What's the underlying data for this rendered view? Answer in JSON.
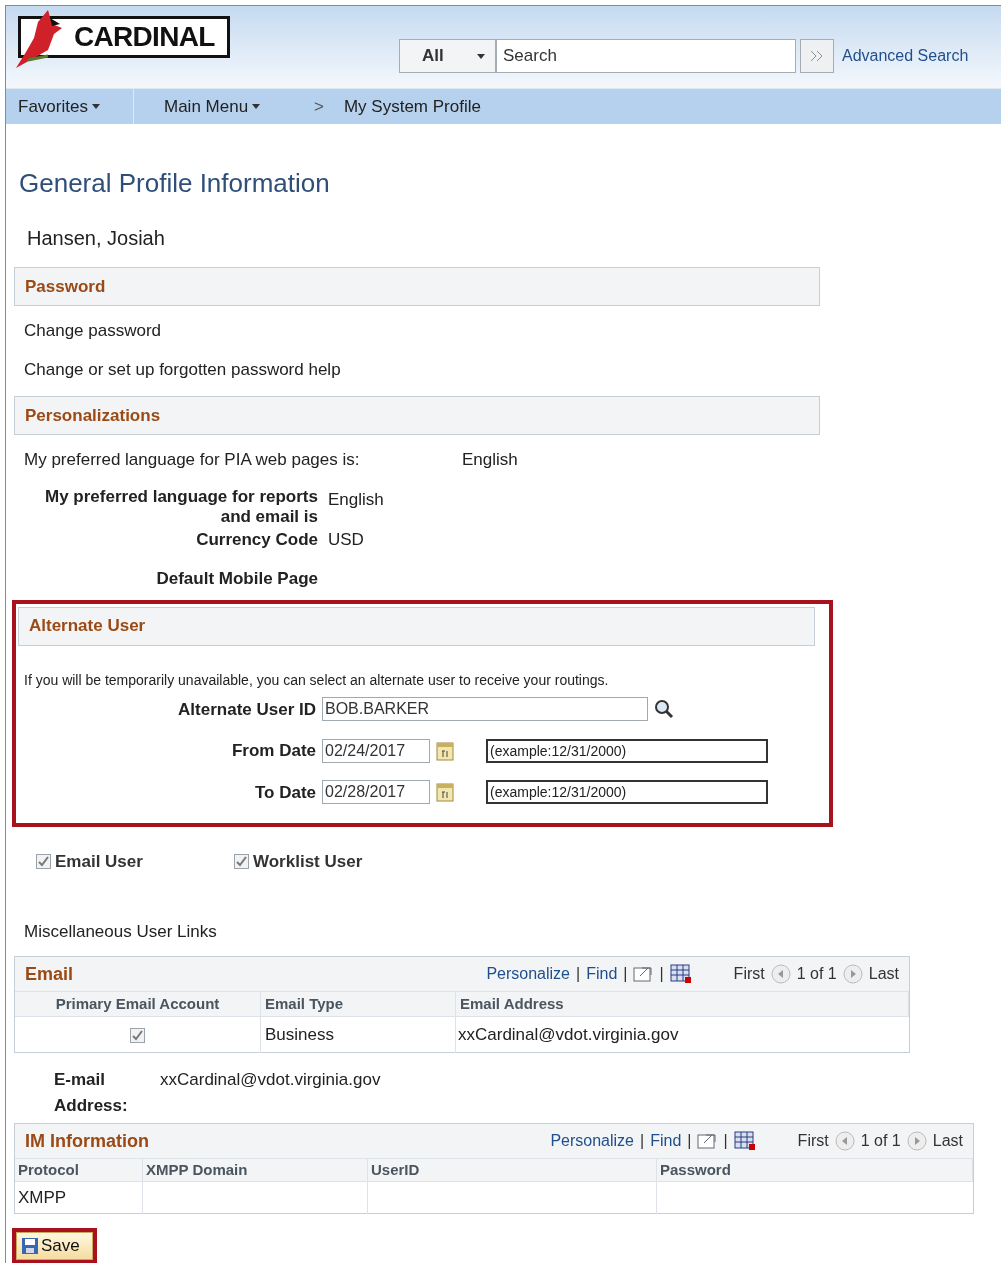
{
  "header": {
    "logo": "CARDINAL",
    "search_scope": "All",
    "search_placeholder": "Search",
    "advanced_search": "Advanced Search"
  },
  "nav": [
    {
      "label": "Favorites",
      "kind": "menu"
    },
    {
      "label": "Main Menu",
      "kind": "menu"
    },
    {
      "label": "My System Profile",
      "kind": "crumb",
      "separator": ">"
    }
  ],
  "page_title": "General Profile Information",
  "user_name": "Hansen, Josiah",
  "password": {
    "title": "Password",
    "links": [
      "Change password",
      "Change or set up forgotten password help"
    ]
  },
  "personalizations": {
    "title": "Personalizations",
    "pia_label": "My preferred language for PIA web pages is:",
    "pia_value": "English",
    "reports_label": "My preferred language for reports and email is",
    "reports_value": "English",
    "currency_label": "Currency Code",
    "currency_value": "USD",
    "mobile_label": "Default Mobile Page"
  },
  "alternate_user": {
    "title": "Alternate User",
    "highlighted": true,
    "intro": "If you will be temporarily unavailable, you can select an alternate user to receive your routings.",
    "user_id_label": "Alternate User ID",
    "user_id_value": "BOB.BARKER",
    "from_label": "From Date",
    "from_value": "02/24/2017",
    "from_hint": "(example:12/31/2000)",
    "to_label": "To Date",
    "to_value": "02/28/2017",
    "to_hint": "(example:12/31/2000)"
  },
  "checkboxes": [
    {
      "label": "Email User",
      "checked": true
    },
    {
      "label": "Worklist User",
      "checked": true
    }
  ],
  "misc_links": "Miscellaneous User Links",
  "email_grid": {
    "title": "Email",
    "personalize": "Personalize",
    "find": "Find",
    "separators": [
      "|",
      "|",
      "|"
    ],
    "first": "First",
    "count": "1 of 1",
    "last": "Last",
    "columns": [
      "Primary Email Account",
      "Email Type",
      "Email Address"
    ],
    "rows": [
      {
        "primary": true,
        "type": "Business",
        "address": "xxCardinal@vdot.virginia.gov"
      }
    ]
  },
  "email_address": {
    "label": "E-mail Address:",
    "value": "xxCardinal@vdot.virginia.gov"
  },
  "im_grid": {
    "title": "IM Information",
    "personalize": "Personalize",
    "find": "Find",
    "separators": [
      "|",
      "|",
      "|"
    ],
    "first": "First",
    "count": "1 of 1",
    "last": "Last",
    "columns": [
      "Protocol",
      "XMPP Domain",
      "UserID",
      "Password"
    ],
    "rows": [
      {
        "protocol": "XMPP"
      }
    ]
  },
  "save": {
    "label": "Save",
    "highlighted": true
  }
}
